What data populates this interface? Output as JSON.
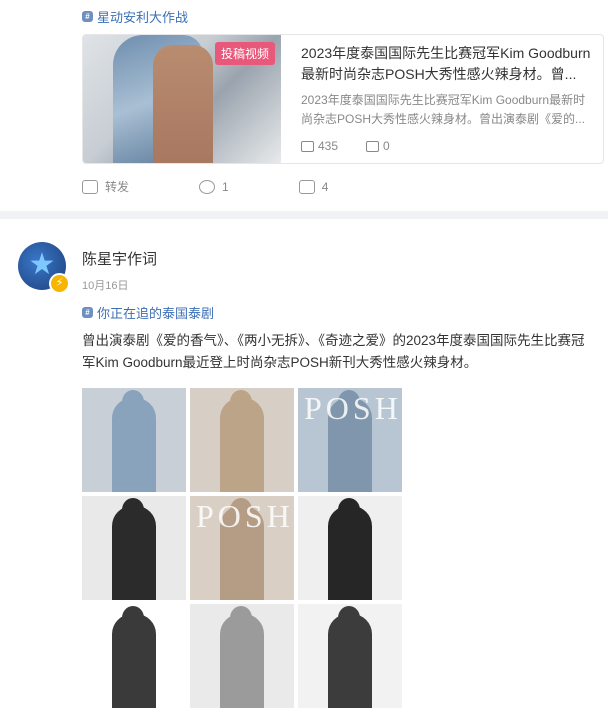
{
  "topic_top": {
    "icon": "topic-icon",
    "label": "星动安利大作战"
  },
  "card": {
    "badge": "投稿视频",
    "title": "2023年度泰国国际先生比赛冠军Kim Goodburn最新时尚杂志POSH大秀性感火辣身材。曾...",
    "desc": "2023年度泰国国际先生比赛冠军Kim Goodburn最新时尚杂志POSH大秀性感火辣身材。曾出演泰剧《爱的...",
    "plays": "435",
    "comments": "0"
  },
  "actions": {
    "repost": "转发",
    "comment": "1",
    "like": "4"
  },
  "post": {
    "username": "陈星宇作词",
    "date": "10月16日",
    "topic": "你正在追的泰国泰剧",
    "text": "曾出演泰剧《爱的香气》、《两小无拆》、《奇迹之爱》的2023年度泰国国际先生比赛冠军Kim Goodburn最近登上时尚杂志POSH新刊大秀性感火辣身材。",
    "photos": [
      {
        "bg": "#c9cfd6",
        "fig": "#8aa3bd",
        "posh": ""
      },
      {
        "bg": "#d7cfc6",
        "fig": "#bba487",
        "posh": ""
      },
      {
        "bg": "#b8c6d4",
        "fig": "#7f96ad",
        "posh": "POSH"
      },
      {
        "bg": "#e9e9e9",
        "fig": "#2b2b2b",
        "posh": ""
      },
      {
        "bg": "#d9cfc5",
        "fig": "#b59c84",
        "posh": "POSH"
      },
      {
        "bg": "#efefef",
        "fig": "#262626",
        "posh": ""
      },
      {
        "bg": "#ffffff",
        "fig": "#3a3a3a",
        "posh": ""
      },
      {
        "bg": "#eaeaea",
        "fig": "#9b9b9b",
        "posh": ""
      },
      {
        "bg": "#f2f2f2",
        "fig": "#3c3c3c",
        "posh": ""
      }
    ]
  }
}
